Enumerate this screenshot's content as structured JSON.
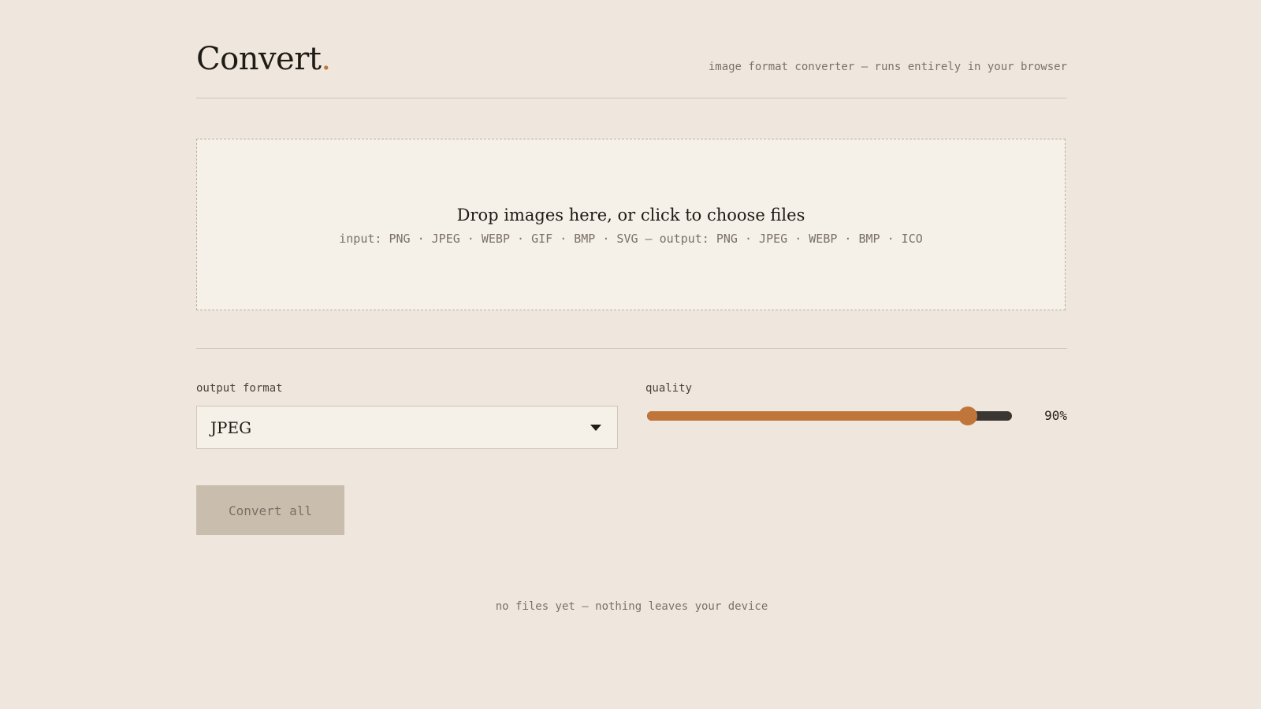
{
  "header": {
    "brand": "Convert",
    "brand_dot": ".",
    "tagline": "image format converter — runs entirely in your browser"
  },
  "dropzone": {
    "title": "Drop images here, or click to choose files",
    "formats": "input: PNG · JPEG · WEBP · GIF · BMP · SVG — output: PNG · JPEG · WEBP · BMP · ICO"
  },
  "settings": {
    "format_label": "output format",
    "format_value": "JPEG",
    "quality_label": "quality",
    "quality_value": "90%",
    "quality_slider_fraction": 0.88
  },
  "actions": {
    "convert_label": "Convert all"
  },
  "status": {
    "empty_note": "no files yet — nothing leaves your device"
  },
  "colors": {
    "background": "#efe7dd",
    "panel": "#f5f0e8",
    "accent": "#c0763a",
    "button_disabled": "#c9beae"
  }
}
